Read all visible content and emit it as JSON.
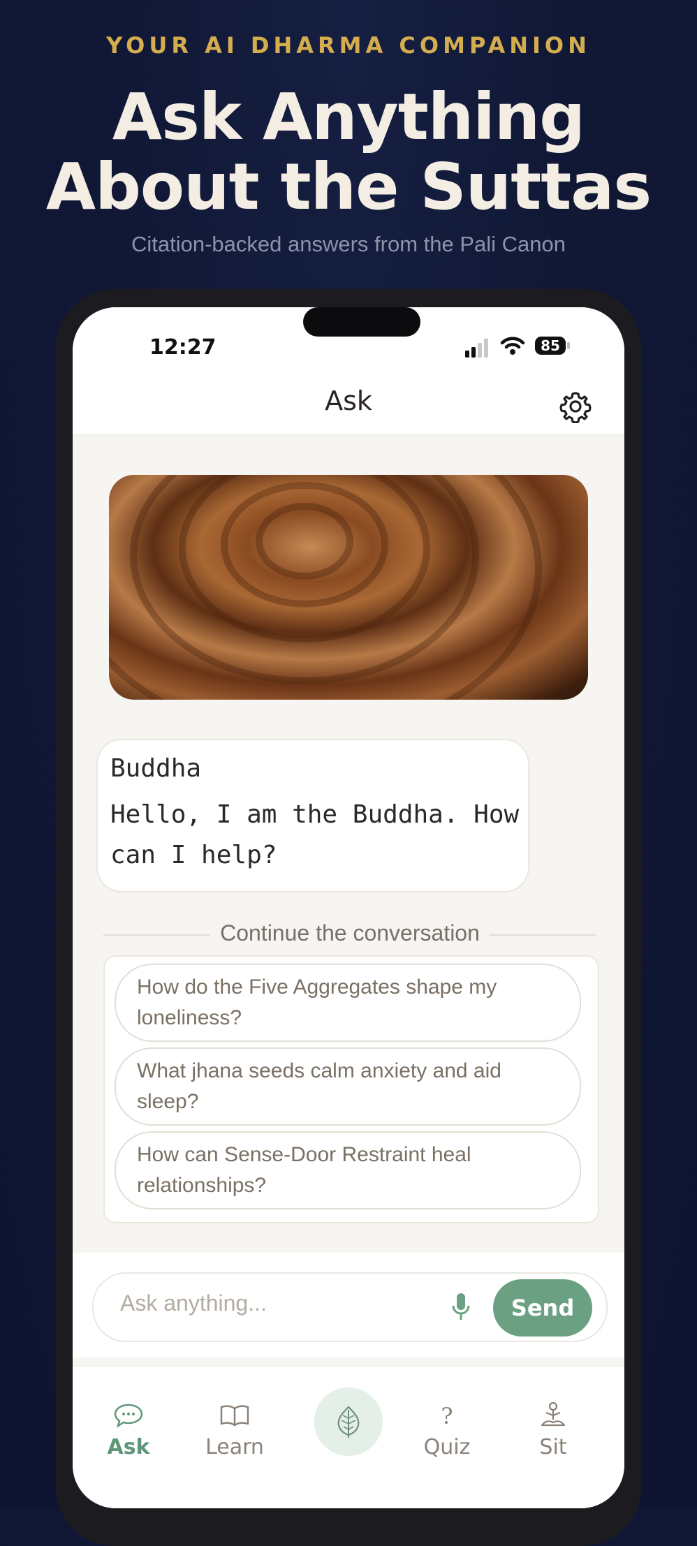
{
  "promo": {
    "kicker": "YOUR AI DHARMA COMPANION",
    "headline_line1": "Ask Anything",
    "headline_line2": "About the Suttas",
    "subhead": "Citation-backed answers from the Pali Canon"
  },
  "status_bar": {
    "time": "12:27",
    "battery": "85"
  },
  "nav": {
    "title": "Ask"
  },
  "chat": {
    "sender": "Buddha",
    "message": "Hello, I am the Buddha. How can I help?"
  },
  "suggestions": {
    "heading": "Continue the conversation",
    "items": [
      "How do the Five Aggregates shape my loneliness?",
      "What jhana seeds calm anxiety and aid sleep?",
      "How can Sense-Door Restraint heal relationships?"
    ]
  },
  "composer": {
    "placeholder": "Ask anything...",
    "send_label": "Send"
  },
  "tabs": [
    {
      "label": "Ask",
      "icon": "chat-bubble-icon",
      "active": true
    },
    {
      "label": "Learn",
      "icon": "book-icon",
      "active": false
    },
    {
      "label": "",
      "icon": "bodhi-leaf-icon",
      "active": false
    },
    {
      "label": "Quiz",
      "icon": "question-icon",
      "active": false
    },
    {
      "label": "Sit",
      "icon": "meditation-icon",
      "active": false
    }
  ],
  "colors": {
    "accent": "#6ba182",
    "gold": "#d4ad4e",
    "background": "#111836"
  }
}
